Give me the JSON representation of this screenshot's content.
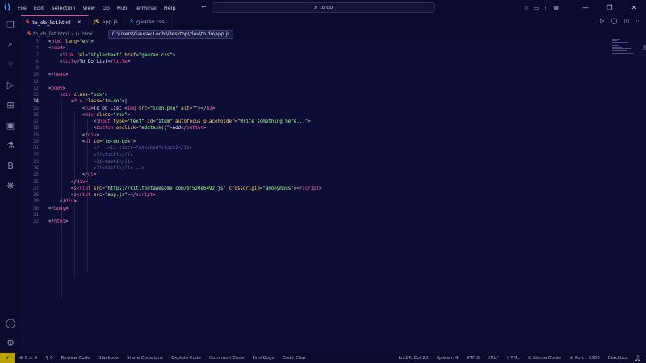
{
  "titlebar": {
    "menu": [
      "File",
      "Edit",
      "Selection",
      "View",
      "Go",
      "Run",
      "Terminal",
      "Help"
    ],
    "search": "to do"
  },
  "tabs": [
    {
      "icon": "5",
      "label": "to_do_list.html",
      "active": true
    },
    {
      "icon": "JS",
      "label": "app.js",
      "active": false
    },
    {
      "icon": "3",
      "label": "gaurav.css",
      "active": false
    }
  ],
  "breadcrumb": {
    "file": "to_do_list.html",
    "element": "html",
    "tooltip": "C:\\Users\\Gaurav Lodhi\\Desktop\\zlev\\to do\\app.js"
  },
  "editor": {
    "current_line": 14,
    "line_numbers": [
      3,
      4,
      7,
      8,
      9,
      10,
      11,
      12,
      13,
      14,
      15,
      16,
      17,
      18,
      19,
      20,
      21,
      22,
      23,
      24,
      25,
      26,
      27,
      28,
      29,
      30,
      31,
      32
    ]
  },
  "statusbar": {
    "errors": "0",
    "warnings": "0",
    "ports_info": "0",
    "left_items": [
      "Review Code",
      "Blackbox",
      "Share Code Link",
      "Explain Code",
      "Comment Code",
      "Find Bugs",
      "Code Chat"
    ],
    "position": "Ln 14, Col 28",
    "spaces": "Spaces: 4",
    "encoding": "UTF-8",
    "eol": "CRLF",
    "language": "HTML",
    "llama": "Llama Coder",
    "port": "Port : 5500",
    "blackbox": "Blackbox"
  }
}
